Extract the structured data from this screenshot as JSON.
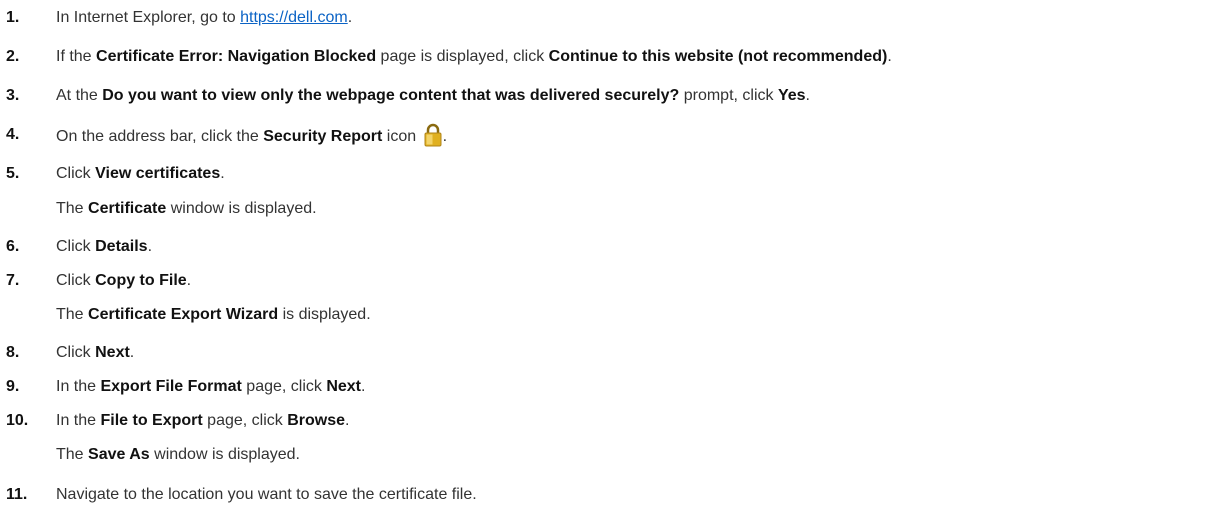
{
  "steps": [
    {
      "num": "1.",
      "t0": "In Internet Explorer, go to ",
      "link": "https://dell.com",
      "t1": "."
    },
    {
      "num": "2.",
      "t0": "If the ",
      "b0": "Certificate Error: Navigation Blocked",
      "t1": " page is displayed, click ",
      "b1": "Continue to this website (not recommended)",
      "t2": "."
    },
    {
      "num": "3.",
      "t0": "At the ",
      "b0": "Do you want to view only the webpage content that was delivered securely?",
      "t1": " prompt, click ",
      "b1": "Yes",
      "t2": "."
    },
    {
      "num": "4.",
      "t0": "On the address bar, click the ",
      "b0": "Security Report",
      "t1": " icon ",
      "icon": "padlock-icon",
      "t2": "."
    },
    {
      "num": "5.",
      "t0": "Click ",
      "b0": "View certificates",
      "t1": "."
    },
    {
      "num": "",
      "t0": "The ",
      "b0": "Certificate",
      "t1": " window is displayed."
    },
    {
      "num": "6.",
      "t0": "Click ",
      "b0": "Details",
      "t1": "."
    },
    {
      "num": "7.",
      "t0": "Click ",
      "b0": "Copy to File",
      "t1": "."
    },
    {
      "num": "",
      "t0": "The ",
      "b0": "Certificate Export Wizard",
      "t1": " is displayed."
    },
    {
      "num": "8.",
      "t0": "Click ",
      "b0": "Next",
      "t1": "."
    },
    {
      "num": "9.",
      "t0": "In the ",
      "b0": "Export File Format",
      "t1": " page, click ",
      "b1": "Next",
      "t2": "."
    },
    {
      "num": "10.",
      "t0": "In the ",
      "b0": "File to Export",
      "t1": " page, click ",
      "b1": "Browse",
      "t2": "."
    },
    {
      "num": "",
      "t0": "The ",
      "b0": "Save As",
      "t1": " window is displayed."
    },
    {
      "num": "11.",
      "t0": "Navigate to the location you want to save the certificate file."
    }
  ],
  "colors": {
    "text": "#333333",
    "bold": "#111111",
    "link": "#0b63c5",
    "lock_body": "#e0b020",
    "lock_shackle": "#8a6a10"
  }
}
